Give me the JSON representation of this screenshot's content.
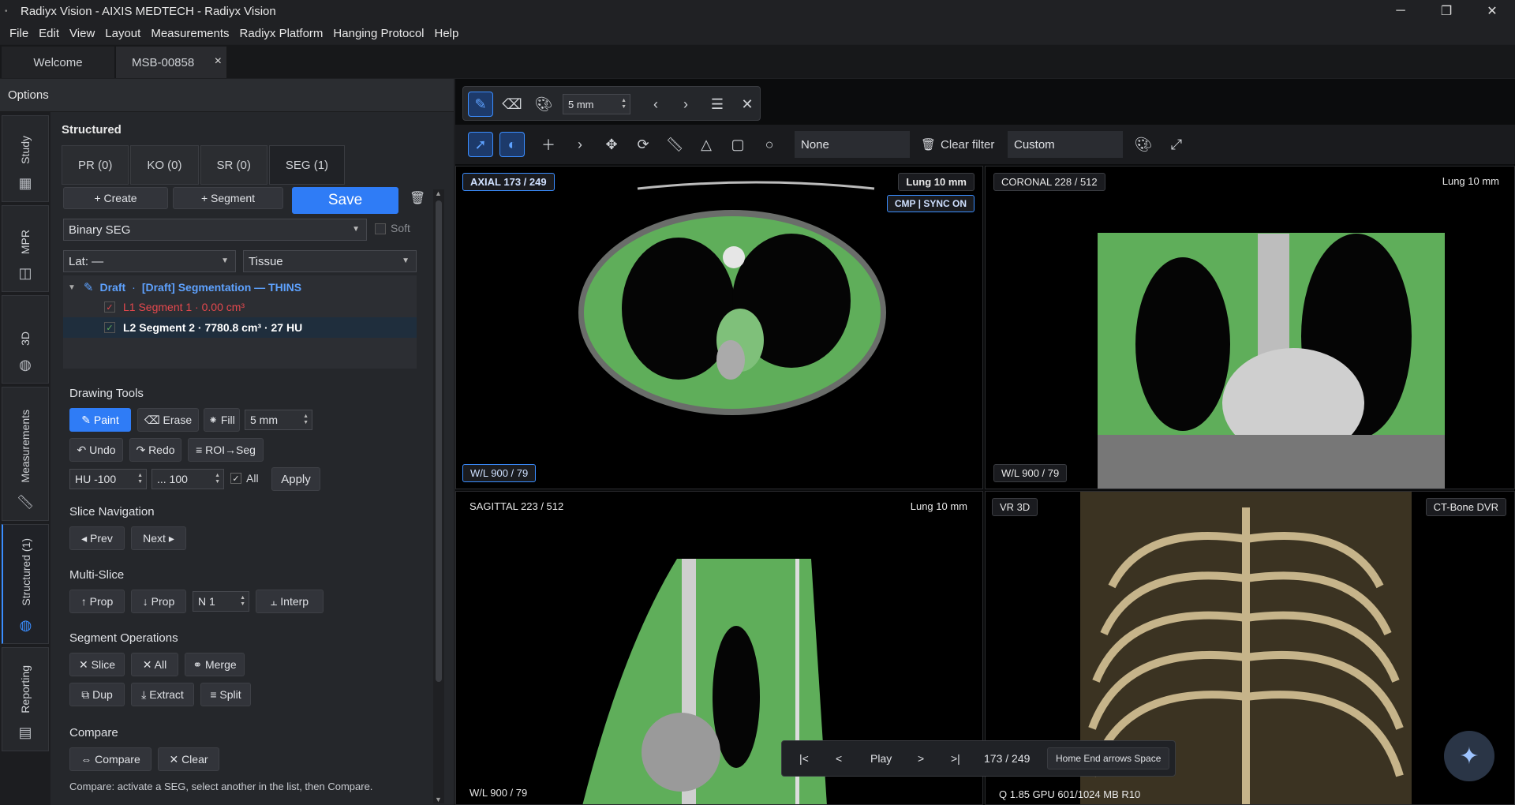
{
  "window": {
    "title": "Radiyx Vision - AIXIS MEDTECH - Radiyx Vision",
    "minimize": "─",
    "maximize": "❐",
    "close": "✕"
  },
  "menu": [
    "File",
    "Edit",
    "View",
    "Layout",
    "Measurements",
    "Radiyx Platform",
    "Hanging Protocol",
    "Help"
  ],
  "tabs": {
    "welcome": "Welcome",
    "active": "MSB-00858",
    "close": "×"
  },
  "options": {
    "title": "Options"
  },
  "sidenav": [
    {
      "label": "Study",
      "icon": "grid-icon"
    },
    {
      "label": "MPR",
      "icon": "layout-icon"
    },
    {
      "label": "3D",
      "icon": "sphere-icon"
    },
    {
      "label": "Measurements",
      "icon": "ruler-icon"
    },
    {
      "label": "Structured (1)",
      "icon": "sphere-icon"
    },
    {
      "label": "Reporting",
      "icon": "report-icon"
    }
  ],
  "panel": {
    "heading": "Structured",
    "tabs": [
      "PR (0)",
      "KO (0)",
      "SR (0)",
      "SEG (1)"
    ],
    "create": "+ Create",
    "segment": "+ Segment",
    "save": "Save",
    "seg_type": "Binary SEG",
    "soft": "Soft",
    "lat": "Lat: —",
    "tissue": "Tissue",
    "tree": {
      "draft": "Draft",
      "draft_name": "[Draft] Segmentation — THINS",
      "seg1": "L1  Segment 1  ·  0.00 cm³",
      "seg2": "L2  Segment 2  ·  7780.8 cm³ · 27 HU"
    },
    "drawing": {
      "title": "Drawing Tools",
      "paint": "✎ Paint",
      "erase": "⌫ Erase",
      "fill": "⁕ Fill",
      "size": "5 mm",
      "undo": "↶ Undo",
      "redo": "↷ Redo",
      "roi": "≡ ROI→Seg",
      "hu_min": "HU -100",
      "hu_max": "... 100",
      "all": "All",
      "apply": "Apply"
    },
    "slice_nav": {
      "title": "Slice Navigation",
      "prev": "◂ Prev",
      "next": "Next ▸"
    },
    "multi": {
      "title": "Multi-Slice",
      "up": "↑ Prop",
      "down": "↓ Prop",
      "n": "N 1",
      "interp": "⫠ Interp"
    },
    "segops": {
      "title": "Segment Operations",
      "slice": "✕ Slice",
      "all": "✕ All",
      "merge": "⚭ Merge",
      "dup": "⧉ Dup",
      "extract": "⤓ Extract",
      "split": "≡ Split"
    },
    "compare": {
      "title": "Compare",
      "compare": "⇔ Compare",
      "clear": "✕ Clear",
      "hint": "Compare: activate a SEG, select another in the list, then Compare."
    }
  },
  "toolbar": {
    "brush_size": "5 mm",
    "filter": "None",
    "clear_filter": "Clear filter",
    "preset": "Custom"
  },
  "viewports": {
    "axial": {
      "label": "AXIAL  173 / 249",
      "preset": "Lung  10 mm",
      "sync": "CMP | SYNC ON",
      "wl": "W/L 900 / 79"
    },
    "coronal": {
      "label": "CORONAL  228 / 512",
      "preset": "Lung  10 mm",
      "wl": "W/L 900 / 79"
    },
    "sagittal": {
      "label": "SAGITTAL  223 / 512",
      "preset": "Lung  10 mm",
      "wl": "W/L 900 / 79"
    },
    "vr": {
      "label": "VR 3D",
      "preset": "CT-Bone  DVR",
      "info": "Q 1.85  GPU 601/1024 MB  R10"
    }
  },
  "player": {
    "first": "|<",
    "prev": "<",
    "play": "Play",
    "next": ">",
    "last": ">|",
    "pos": "173 / 249",
    "keys": "Home End  arrows  Space"
  },
  "colors": {
    "accent": "#2f7cf6",
    "seg_green": "#5fae5a",
    "error_red": "#e5484d"
  }
}
